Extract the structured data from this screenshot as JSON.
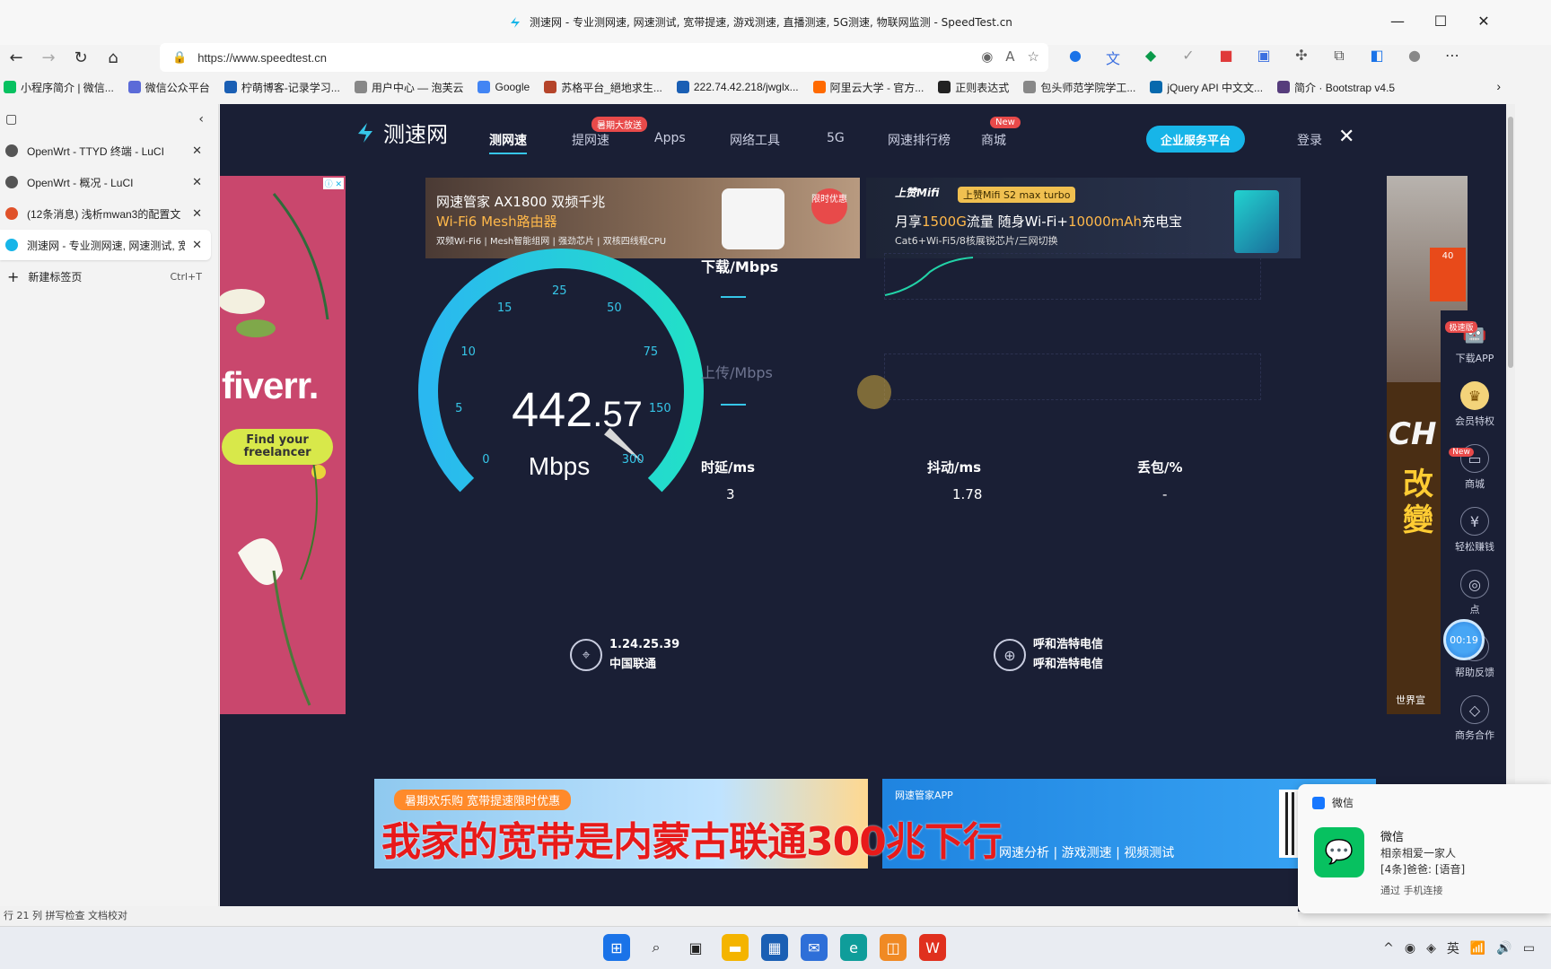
{
  "window": {
    "title": "测速网 - 专业测网速, 网速测试, 宽带提速, 游戏测速, 直播测速, 5G测速, 物联网监测 - SpeedTest.cn",
    "url": "https://www.speedtest.cn"
  },
  "bookmarks": [
    {
      "label": "小程序简介 | 微信...",
      "color": "#07c160"
    },
    {
      "label": "微信公众平台",
      "color": "#5b6bd8"
    },
    {
      "label": "柠萌博客-记录学习...",
      "color": "#1a5fb4"
    },
    {
      "label": "用户中心 — 泡芙云",
      "color": "#888888"
    },
    {
      "label": "Google",
      "color": "#4285f4"
    },
    {
      "label": "苏格平台_絕地求生...",
      "color": "#b5442a"
    },
    {
      "label": "222.74.42.218/jwglx...",
      "color": "#1a5fb4"
    },
    {
      "label": "阿里云大学 - 官方...",
      "color": "#ff6a00"
    },
    {
      "label": "正则表达式",
      "color": "#222222"
    },
    {
      "label": "包头师范学院学工...",
      "color": "#888888"
    },
    {
      "label": "jQuery API 中文文...",
      "color": "#0769ad"
    },
    {
      "label": "简介 · Bootstrap v4.5",
      "color": "#563d7c"
    }
  ],
  "tabs": [
    {
      "label": "OpenWrt - TTYD 终端 - LuCI",
      "color": "#555555",
      "active": false
    },
    {
      "label": "OpenWrt - 概况 - LuCI",
      "color": "#555555",
      "active": false
    },
    {
      "label": "(12条消息) 浅析mwan3的配置文",
      "color": "#e0522a",
      "active": false
    },
    {
      "label": "测速网 - 专业测网速, 网速测试, 宽",
      "color": "#17b5e8",
      "active": true
    }
  ],
  "newtab": {
    "label": "新建标签页",
    "shortcut": "Ctrl+T"
  },
  "site": {
    "logo": "测速网",
    "nav": [
      {
        "label": "测网速",
        "active": true
      },
      {
        "label": "提网速",
        "badge": "暑期大放送"
      },
      {
        "label": "Apps"
      },
      {
        "label": "网络工具"
      },
      {
        "label": "5G"
      },
      {
        "label": "网速排行榜"
      },
      {
        "label": "商城",
        "badge": "New"
      }
    ],
    "enterprise": "企业服务平台",
    "login": "登录"
  },
  "ads": {
    "left_brand": "fiverr.",
    "left_cta": "Find your freelancer",
    "top1": {
      "line1": "网速管家 AX1800 双频千兆",
      "line2": "Wi-Fi6 Mesh路由器",
      "line3": "双频Wi-Fi6 | Mesh智能组网 | 强劲芯片 | 双核四线程CPU",
      "badge": "限时优惠"
    },
    "top2": {
      "brand": "上赞Mifi",
      "pill": "上赞Mifi S2 max turbo",
      "line1a": "月享",
      "line1b": "1500G",
      "line1c": "流量 随身Wi-Fi+",
      "line1d": "10000mAh",
      "line1e": "充电宝",
      "line2": "Cat6+Wi-Fi5/8核展锐芯片/三网切换"
    },
    "right": {
      "big1": "CH",
      "big2": "改變",
      "bottom": "世界宣"
    },
    "bottom1_tag": "暑期欢乐购 宽带提速限时优惠",
    "bottom2_tag": "网速管家APP",
    "bottom2_sub": "网速分析 | 游戏测速 | 视频测试"
  },
  "rail": [
    {
      "label": "下载APP",
      "icon": "android-icon",
      "glyph": "🤖",
      "badge": "极速版"
    },
    {
      "label": "会员特权",
      "icon": "crown-icon",
      "glyph": "♛"
    },
    {
      "label": "商城",
      "icon": "store-icon",
      "glyph": "▭",
      "badge": "New"
    },
    {
      "label": "轻松赚钱",
      "icon": "money-bag-icon",
      "glyph": "¥"
    },
    {
      "label": "点",
      "icon": "points-icon",
      "glyph": "◎"
    },
    {
      "label": "帮助反馈",
      "icon": "headset-icon",
      "glyph": "☊"
    },
    {
      "label": "商务合作",
      "icon": "handshake-icon",
      "glyph": "◇"
    }
  ],
  "timer": "00:19",
  "gauge": {
    "ticks": [
      "0",
      "5",
      "10",
      "15",
      "25",
      "50",
      "75",
      "150",
      "300"
    ],
    "speed_int": "442",
    "speed_dec": ".57",
    "unit": "Mbps",
    "value": 442.57,
    "max": 300
  },
  "download": {
    "label": "下载/Mbps",
    "value": "—"
  },
  "upload": {
    "label": "上传/Mbps",
    "value": "—"
  },
  "stats": [
    {
      "label": "时延/ms",
      "value": "3"
    },
    {
      "label": "抖动/ms",
      "value": "1.78"
    },
    {
      "label": "丢包/%",
      "value": "-"
    }
  ],
  "client": {
    "ip": "1.24.25.39",
    "isp": "中国联通"
  },
  "server": {
    "name": "呼和浩特电信",
    "isp": "呼和浩特电信"
  },
  "caption": "我家的宽带是内蒙古联通300兆下行",
  "notification": {
    "app": "微信",
    "title": "微信",
    "line1": "相亲相爱一家人",
    "line2": "[4条]爸爸: [语音]",
    "line3": "通过 手机连接"
  },
  "statusbar": "行 21  列 拼写检查  文档校对"
}
